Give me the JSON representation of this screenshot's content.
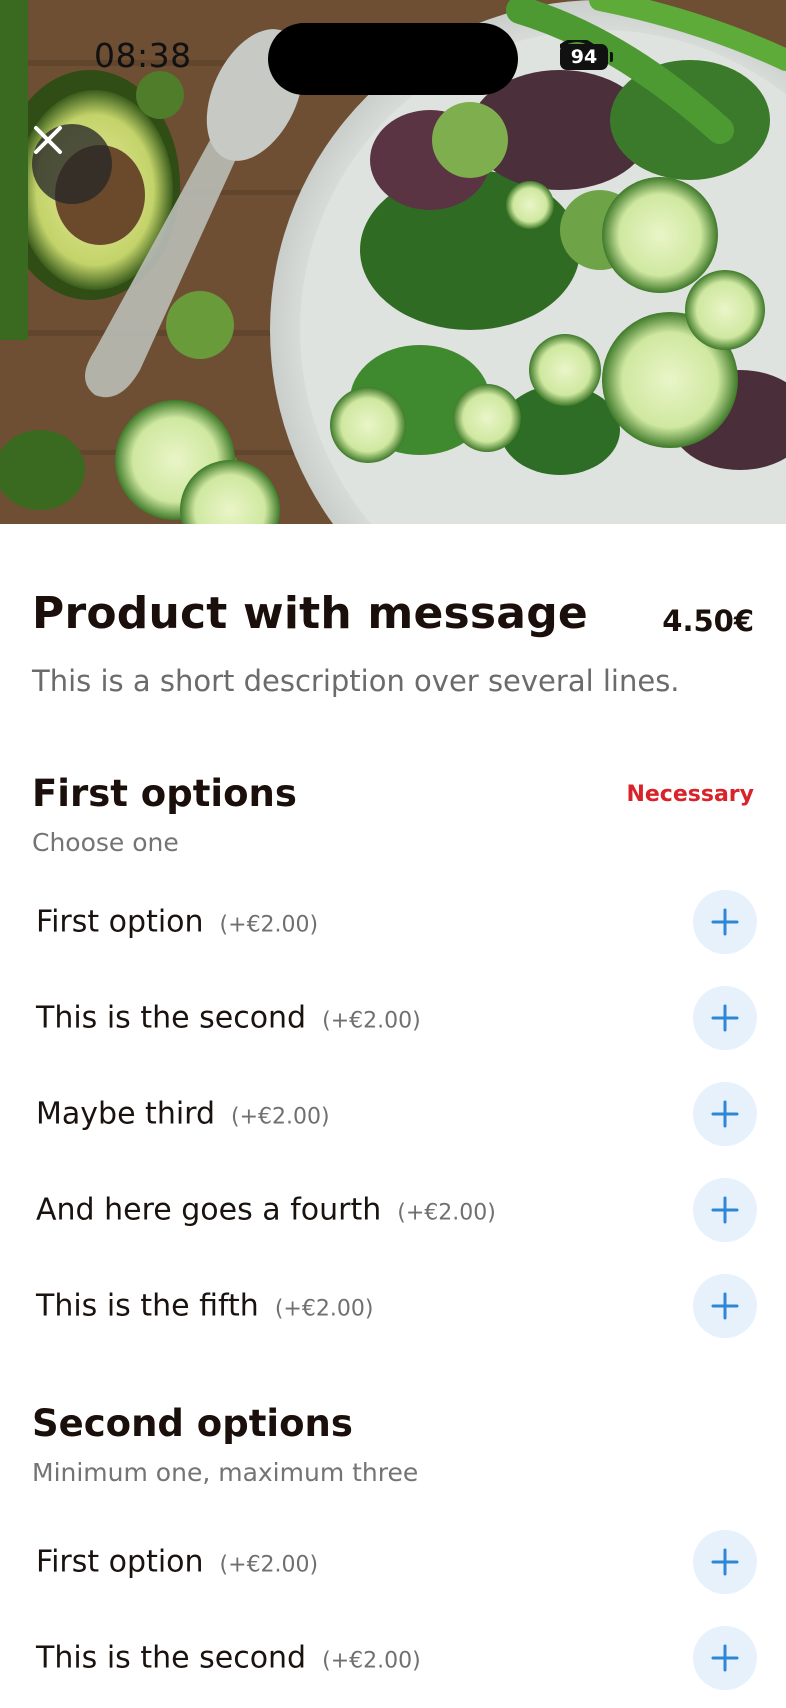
{
  "status_bar": {
    "time": "08:38",
    "battery": "94"
  },
  "hero": {
    "close_icon": "close-icon"
  },
  "product": {
    "title": "Product with message",
    "price": "4.50€",
    "description": "This is a short description over several lines."
  },
  "groups": [
    {
      "title": "First options",
      "subtitle": "Choose one",
      "badge": "Necessary",
      "options": [
        {
          "name": "First option",
          "price": "(+€2.00)"
        },
        {
          "name": "This is the second",
          "price": "(+€2.00)"
        },
        {
          "name": "Maybe third",
          "price": "(+€2.00)"
        },
        {
          "name": "And here goes a fourth",
          "price": "(+€2.00)"
        },
        {
          "name": "This is the fifth",
          "price": "(+€2.00)"
        }
      ]
    },
    {
      "title": "Second options",
      "subtitle": "Minimum one, maximum three",
      "options": [
        {
          "name": "First option",
          "price": "(+€2.00)"
        },
        {
          "name": "This is the second",
          "price": "(+€2.00)"
        }
      ]
    }
  ],
  "colors": {
    "accent_blue": "#2e86d6",
    "add_button_bg": "#e7f1fb",
    "badge_red": "#d8232a",
    "title_text": "#1a0f0a"
  }
}
